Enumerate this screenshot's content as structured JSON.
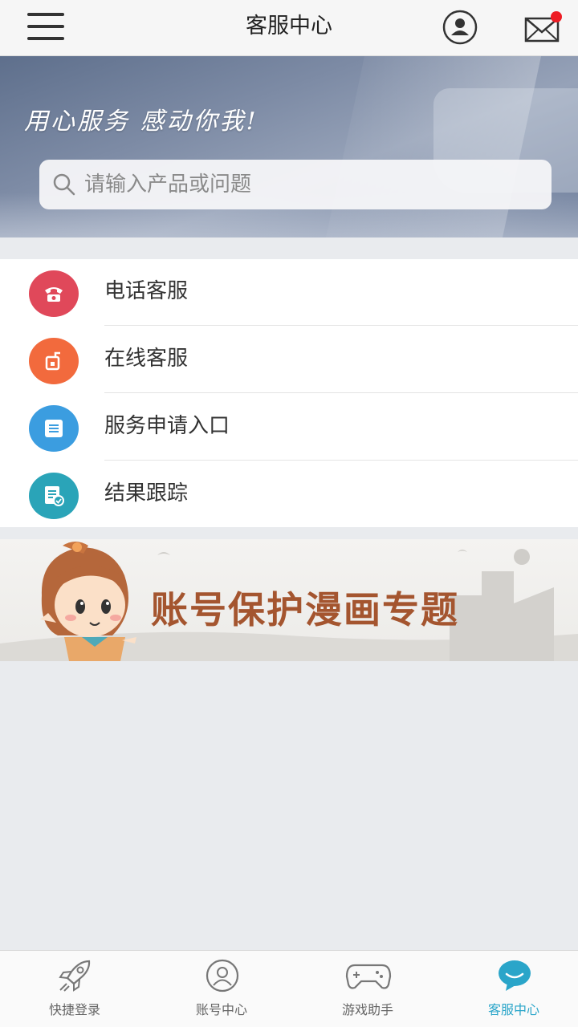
{
  "header": {
    "title": "客服中心",
    "has_unread": true,
    "badge_color": "#ee1c24"
  },
  "banner": {
    "slogan": "用心服务 感动你我!",
    "search": {
      "placeholder": "请输入产品或问题",
      "value": ""
    }
  },
  "menu": {
    "items": [
      {
        "label": "电话客服",
        "icon": "phone-icon",
        "color": "#e0485a"
      },
      {
        "label": "在线客服",
        "icon": "chat-icon",
        "color": "#f26a3d"
      },
      {
        "label": "服务申请入口",
        "icon": "form-icon",
        "color": "#3b9de0"
      },
      {
        "label": "结果跟踪",
        "icon": "track-icon",
        "color": "#2aa4b8"
      }
    ]
  },
  "promo": {
    "title": "账号保护漫画专题",
    "title_color": "#a4552f"
  },
  "tabbar": {
    "active_color": "#2aa5c9",
    "tabs": [
      {
        "label": "快捷登录",
        "icon": "rocket-icon"
      },
      {
        "label": "账号中心",
        "icon": "user-icon"
      },
      {
        "label": "游戏助手",
        "icon": "gamepad-icon"
      },
      {
        "label": "客服中心",
        "icon": "speech-bubble-icon",
        "active": true
      }
    ]
  }
}
